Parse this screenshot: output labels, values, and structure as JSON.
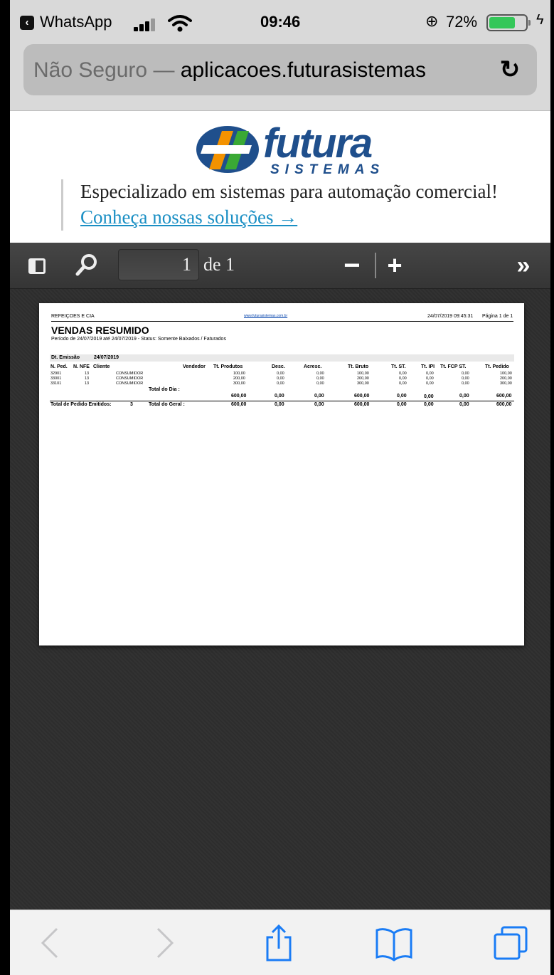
{
  "status_bar": {
    "back_app": "WhatsApp",
    "time": "09:46",
    "battery_pct": "72%",
    "battery_level": 0.72,
    "colors": {
      "battery": "#34c759"
    }
  },
  "url_bar": {
    "security": "Não Seguro —",
    "host": "aplicacoes.futurasistemas"
  },
  "banner": {
    "logo_word": "futura",
    "logo_sub": "SISTEMAS",
    "tagline": "Especializado em sistemas para automação comercial!",
    "cta": "Conheça nossas soluções →",
    "colors": {
      "brand": "#1f4f8c",
      "link": "#1a8fc4"
    }
  },
  "pdf_toolbar": {
    "page_number": "1",
    "page_of": "de 1"
  },
  "report": {
    "company": "REFEIÇOES E CIA",
    "site": "www.futurasistemas.com.br",
    "generated": "24/07/2019 09:45:31",
    "page_label": "Página 1 de 1",
    "title": "VENDAS RESUMIDO",
    "period": "Período de 24/07/2019 até 24/07/2019 - Status: Somente Baixados / Faturados",
    "emission_label": "Dt. Emissão",
    "emission_date": "24/07/2019",
    "columns": {
      "n_ped": "N. Ped.",
      "n_nfe": "N. NFE",
      "cliente": "Cliente",
      "vendedor": "Vendedor",
      "tt_produtos": "Tt. Produtos",
      "desc": "Desc.",
      "acresc": "Acresc.",
      "tt_bruto": "Tt. Bruto",
      "tt_st": "Tt. ST.",
      "tt_ipi": "Tt. IPI",
      "tt_fcp_st": "Tt. FCP ST.",
      "tt_pedido": "Tt. Pedido"
    },
    "rows": [
      {
        "n_ped": "32901",
        "n_nfe": "13",
        "cliente": "CONSUMIDOR",
        "tt_produtos": "100,00",
        "desc": "0,00",
        "acresc": "0,00",
        "tt_bruto": "100,00",
        "tt_st": "0,00",
        "tt_ipi": "0,00",
        "tt_fcp_st": "0,00",
        "tt_pedido": "100,00"
      },
      {
        "n_ped": "33001",
        "n_nfe": "13",
        "cliente": "CONSUMIDOR",
        "tt_produtos": "200,00",
        "desc": "0,00",
        "acresc": "0,00",
        "tt_bruto": "200,00",
        "tt_st": "0,00",
        "tt_ipi": "0,00",
        "tt_fcp_st": "0,00",
        "tt_pedido": "200,00"
      },
      {
        "n_ped": "33101",
        "n_nfe": "13",
        "cliente": "CONSUMIDOR",
        "tt_produtos": "300,00",
        "desc": "0,00",
        "acresc": "0,00",
        "tt_bruto": "300,00",
        "tt_st": "0,00",
        "tt_ipi": "0,00",
        "tt_fcp_st": "0,00",
        "tt_pedido": "300,00"
      }
    ],
    "day_total": {
      "label": "Total do Dia :",
      "tt_produtos": "600,00",
      "desc": "0,00",
      "acresc": "0,00",
      "tt_bruto": "600,00",
      "tt_st": "0,00",
      "tt_ipi": "0,00",
      "tt_fcp_st": "0,00",
      "tt_pedido": "600,00"
    },
    "grand_total": {
      "count_label": "Total de Pedido Emitidos:",
      "count": "3",
      "label": "Total do Geral :",
      "tt_produtos": "600,00",
      "desc": "0,00",
      "acresc": "0,00",
      "tt_bruto": "600,00",
      "tt_st": "0,00",
      "tt_ipi": "0,00",
      "tt_fcp_st": "0,00",
      "tt_pedido": "600,00"
    }
  },
  "bottom_toolbar": {
    "icons": [
      "back-icon",
      "forward-icon",
      "share-icon",
      "bookmarks-icon",
      "tabs-icon"
    ],
    "colors": {
      "active": "#1a7cf5",
      "disabled": "#c6c6c8"
    }
  }
}
